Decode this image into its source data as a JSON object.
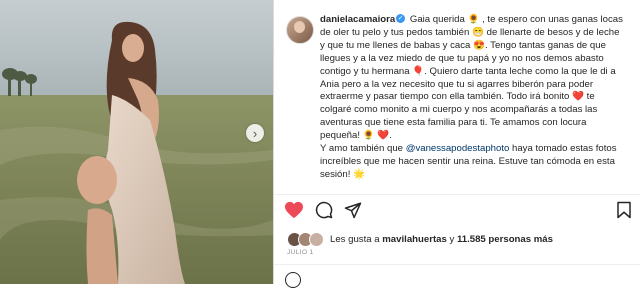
{
  "post": {
    "username": "danielacamaiora",
    "verified_mark": "✓",
    "caption_part1": "Gaia querida 🌻 , te espero con unas ganas locas de oler tu pelo y tus pedos también 😁 de llenarte de besos y de leche y que tu me llenes de babas y caca 😍. Tengo tantas ganas de que llegues y a la vez miedo de que tu papá y yo no nos demos abasto contigo y tu hermana 🎈. Quiero darte tanta leche como la que le di a Ania pero a la vez necesito que tu si agarres biberón para poder extraerme y pasar tiempo con ella también. Todo irá bonito ❤️ te colgaré como monito a mi cuerpo y nos acompañarás a todas las aventuras que tiene esta familia para ti. Te amamos con locura pequeña! 🌻 ❤️.",
    "caption_part2_prefix": "Y amo también que",
    "mention": "@vanessapodestaphoto",
    "caption_part2_suffix": "haya tomado estas fotos increíbles que me hacen sentir una reina. Estuve tan cómoda en esta sesión! 🌟"
  },
  "likes": {
    "prefix": "Les gusta a",
    "user": "mavilahuertas",
    "middle": "y",
    "count": "11.585 personas más"
  },
  "date": "JULIO 1",
  "icons": {
    "like": "heart-icon",
    "comment": "comment-icon",
    "share": "share-icon",
    "save": "bookmark-icon",
    "next": "chevron-right-icon",
    "emoji": "emoji-icon"
  },
  "colors": {
    "like_red": "#ed4956",
    "mention_blue": "#00376b",
    "verified_blue": "#3897f0",
    "muted": "#8e8e8e"
  }
}
